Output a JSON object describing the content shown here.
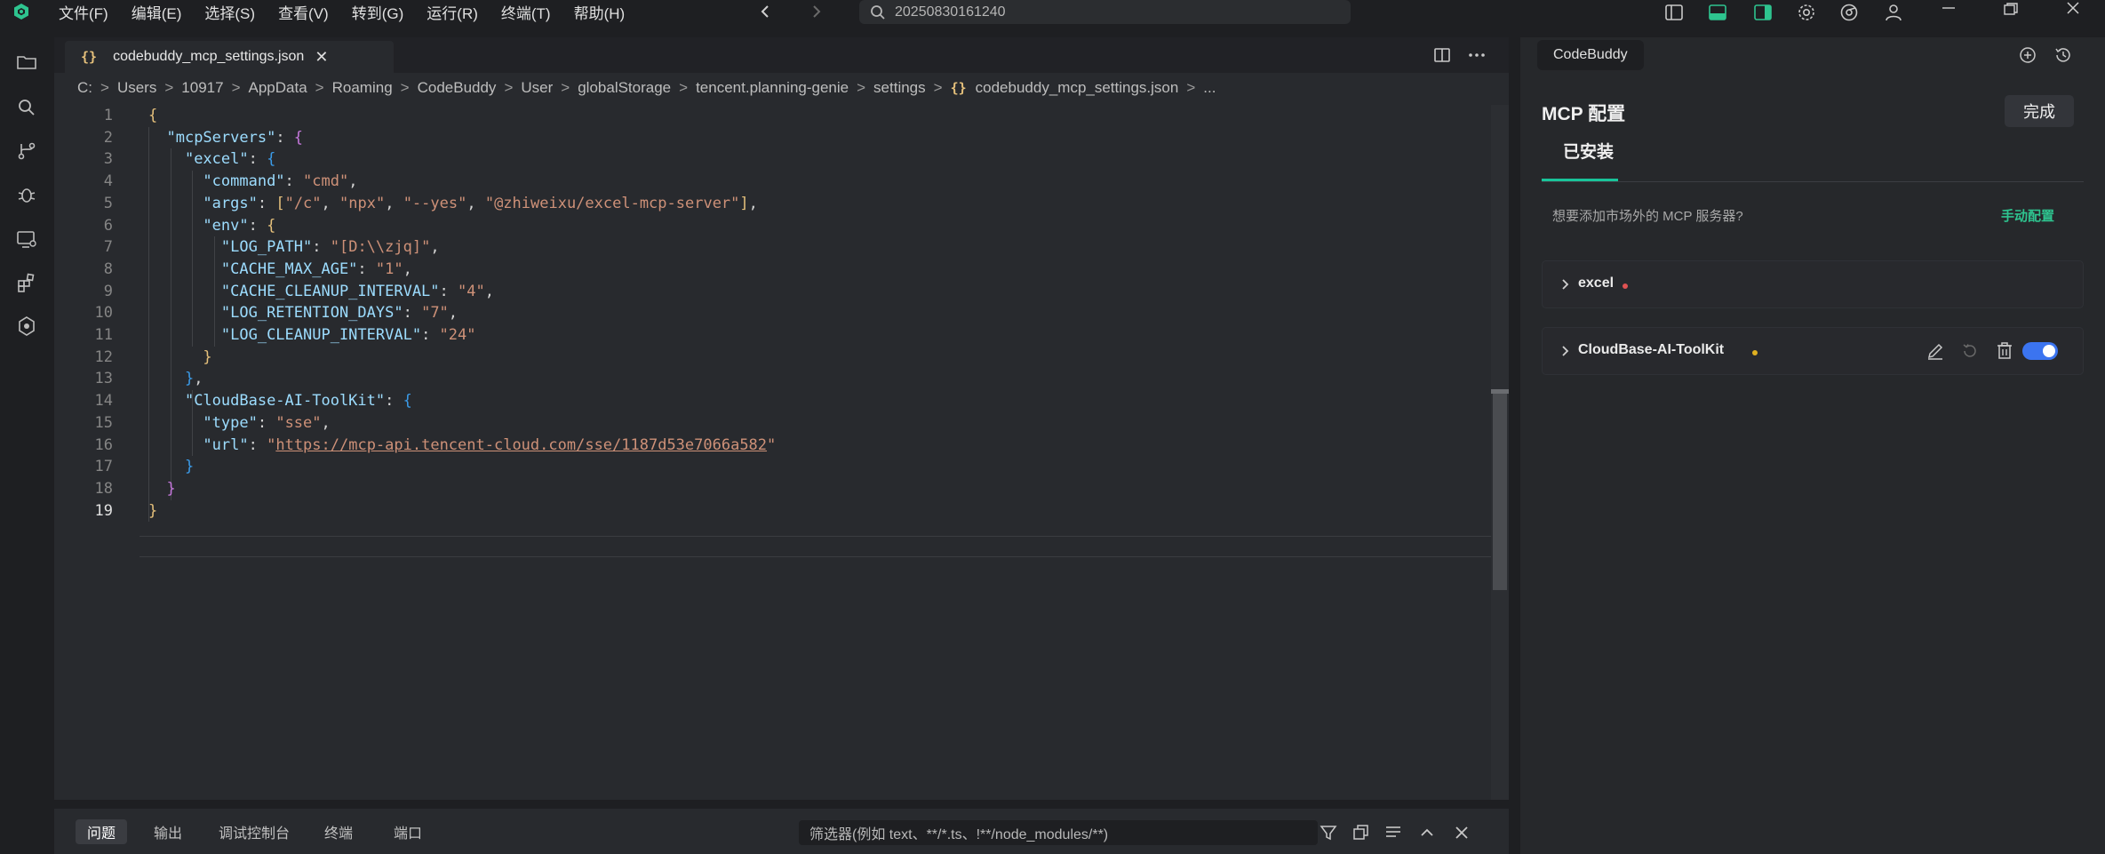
{
  "menu": [
    "文件(F)",
    "编辑(E)",
    "选择(S)",
    "查看(V)",
    "转到(G)",
    "运行(R)",
    "终端(T)",
    "帮助(H)"
  ],
  "search": {
    "text": "20250830161240"
  },
  "editor": {
    "tab_label": "codebuddy_mcp_settings.json",
    "tab_braces": "{}",
    "breadcrumb": [
      "C:",
      "Users",
      "10917",
      "AppData",
      "Roaming",
      "CodeBuddy",
      "User",
      "globalStorage",
      "tencent.planning-genie",
      "settings"
    ],
    "breadcrumb_file": "codebuddy_mcp_settings.json",
    "breadcrumb_more": "...",
    "current_line": 19
  },
  "code": [
    {
      "n": "1",
      "t": [
        [
          "b1",
          "{"
        ]
      ]
    },
    {
      "n": "2",
      "t": [
        [
          "p",
          "  "
        ],
        [
          "k",
          "\"mcpServers\""
        ],
        [
          "p",
          ": "
        ],
        [
          "b2",
          "{"
        ]
      ]
    },
    {
      "n": "3",
      "t": [
        [
          "p",
          "    "
        ],
        [
          "k",
          "\"excel\""
        ],
        [
          "p",
          ": "
        ],
        [
          "b3",
          "{"
        ]
      ]
    },
    {
      "n": "4",
      "t": [
        [
          "p",
          "      "
        ],
        [
          "k",
          "\"command\""
        ],
        [
          "p",
          ": "
        ],
        [
          "s",
          "\"cmd\""
        ],
        [
          "p",
          ","
        ]
      ]
    },
    {
      "n": "5",
      "t": [
        [
          "p",
          "      "
        ],
        [
          "k",
          "\"args\""
        ],
        [
          "p",
          ": "
        ],
        [
          "b1",
          "["
        ],
        [
          "s",
          "\"/c\""
        ],
        [
          "p",
          ", "
        ],
        [
          "s",
          "\"npx\""
        ],
        [
          "p",
          ", "
        ],
        [
          "s",
          "\"--yes\""
        ],
        [
          "p",
          ", "
        ],
        [
          "s",
          "\"@zhiweixu/excel-mcp-server\""
        ],
        [
          "b1",
          "]"
        ],
        [
          "p",
          ","
        ]
      ]
    },
    {
      "n": "6",
      "t": [
        [
          "p",
          "      "
        ],
        [
          "k",
          "\"env\""
        ],
        [
          "p",
          ": "
        ],
        [
          "b1",
          "{"
        ]
      ]
    },
    {
      "n": "7",
      "t": [
        [
          "p",
          "        "
        ],
        [
          "k",
          "\"LOG_PATH\""
        ],
        [
          "p",
          ": "
        ],
        [
          "s",
          "\"[D:\\\\zjq]\""
        ],
        [
          "p",
          ","
        ]
      ]
    },
    {
      "n": "8",
      "t": [
        [
          "p",
          "        "
        ],
        [
          "k",
          "\"CACHE_MAX_AGE\""
        ],
        [
          "p",
          ": "
        ],
        [
          "s",
          "\"1\""
        ],
        [
          "p",
          ","
        ]
      ]
    },
    {
      "n": "9",
      "t": [
        [
          "p",
          "        "
        ],
        [
          "k",
          "\"CACHE_CLEANUP_INTERVAL\""
        ],
        [
          "p",
          ": "
        ],
        [
          "s",
          "\"4\""
        ],
        [
          "p",
          ","
        ]
      ]
    },
    {
      "n": "10",
      "t": [
        [
          "p",
          "        "
        ],
        [
          "k",
          "\"LOG_RETENTION_DAYS\""
        ],
        [
          "p",
          ": "
        ],
        [
          "s",
          "\"7\""
        ],
        [
          "p",
          ","
        ]
      ]
    },
    {
      "n": "11",
      "t": [
        [
          "p",
          "        "
        ],
        [
          "k",
          "\"LOG_CLEANUP_INTERVAL\""
        ],
        [
          "p",
          ": "
        ],
        [
          "s",
          "\"24\""
        ]
      ]
    },
    {
      "n": "12",
      "t": [
        [
          "p",
          "      "
        ],
        [
          "b1",
          "}"
        ]
      ]
    },
    {
      "n": "13",
      "t": [
        [
          "p",
          "    "
        ],
        [
          "b3",
          "}"
        ],
        [
          "p",
          ","
        ]
      ]
    },
    {
      "n": "14",
      "t": [
        [
          "p",
          "    "
        ],
        [
          "k",
          "\"CloudBase-AI-ToolKit\""
        ],
        [
          "p",
          ": "
        ],
        [
          "b3",
          "{"
        ]
      ]
    },
    {
      "n": "15",
      "t": [
        [
          "p",
          "      "
        ],
        [
          "k",
          "\"type\""
        ],
        [
          "p",
          ": "
        ],
        [
          "s",
          "\"sse\""
        ],
        [
          "p",
          ","
        ]
      ]
    },
    {
      "n": "16",
      "t": [
        [
          "p",
          "      "
        ],
        [
          "k",
          "\"url\""
        ],
        [
          "p",
          ": "
        ],
        [
          "s",
          "\""
        ],
        [
          "url",
          "https://mcp-api.tencent-cloud.com/sse/1187d53e7066a582"
        ],
        [
          "s",
          "\""
        ]
      ]
    },
    {
      "n": "17",
      "t": [
        [
          "p",
          "    "
        ],
        [
          "b3",
          "}"
        ]
      ]
    },
    {
      "n": "18",
      "t": [
        [
          "p",
          "  "
        ],
        [
          "b2",
          "}"
        ]
      ]
    },
    {
      "n": "19",
      "t": [
        [
          "b1",
          "}"
        ]
      ]
    }
  ],
  "panel": {
    "tabs": [
      "问题",
      "输出",
      "调试控制台",
      "终端",
      "端口"
    ],
    "filter_placeholder": "筛选器(例如 text、**/*.ts、!**/node_modules/**)"
  },
  "side": {
    "chip": "CodeBuddy",
    "title": "MCP 配置",
    "done": "完成",
    "tab_installed": "已安装",
    "market_text": "想要添加市场外的 MCP 服务器?",
    "manual_link": "手动配置",
    "servers": [
      {
        "name": "excel",
        "status_color": "#e05252"
      },
      {
        "name": "CloudBase-AI-ToolKit",
        "status_color": "#e0b020",
        "enabled": true
      }
    ]
  },
  "colors": {
    "accent": "#19c49a",
    "toggle": "#3b74f0",
    "logo": "#2ec48f"
  }
}
